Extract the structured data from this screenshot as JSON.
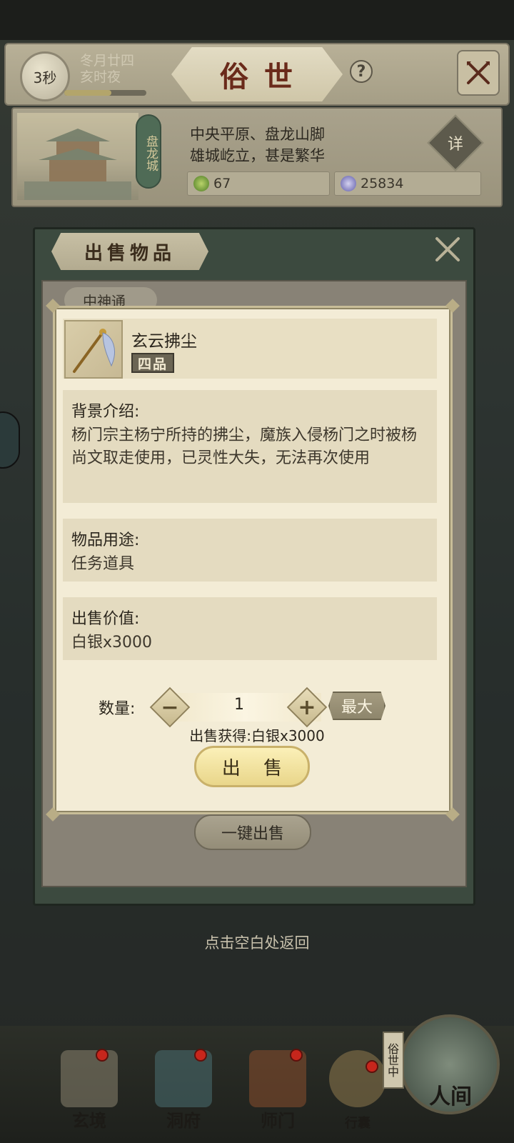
{
  "header": {
    "timer": "3秒",
    "date_line1": "冬月廿四",
    "date_line2": "亥时夜",
    "title": "俗世",
    "help_symbol": "?"
  },
  "location": {
    "city_name": "盘龙城",
    "desc_line1": "中央平原、盘龙山脚",
    "desc_line2": "雄城屹立，甚是繁华",
    "resource_green": "67",
    "resource_silver": "25834",
    "detail_label": "详"
  },
  "sell_panel": {
    "title": "出售物品",
    "tab_peek": "中神通",
    "one_key_sell": "一键出售"
  },
  "item": {
    "name": "玄云拂尘",
    "grade": "四品",
    "background_title": "背景介绍:",
    "background_text": "杨门宗主杨宁所持的拂尘，魔族入侵杨门之时被杨尚文取走使用，已灵性大失，无法再次使用",
    "usage_title": "物品用途:",
    "usage_text": "任务道具",
    "value_title": "出售价值:",
    "value_text": "白银x3000"
  },
  "sell_form": {
    "qty_label": "数量:",
    "qty_value": "1",
    "max_label": "最大",
    "gain_text": "出售获得:白银x3000",
    "sell_button": "出 售"
  },
  "return_hint": "点击空白处返回",
  "bottom_nav": {
    "items": [
      {
        "label": "玄境"
      },
      {
        "label": "洞府"
      },
      {
        "label": "师门"
      },
      {
        "label": "行囊"
      }
    ],
    "world_label": "人间",
    "world_tag": "俗世中"
  },
  "colors": {
    "dialog_bg": "#f3ecd6",
    "sell_button": "#e9d68a",
    "title_red": "#6a2a1a",
    "badge_red": "#c7261c"
  },
  "icons": {
    "header_close": "crossed-swords-close-icon",
    "resource_green": "leaf-icon",
    "resource_silver": "silver-coin-icon",
    "item": "whisk-icon"
  }
}
